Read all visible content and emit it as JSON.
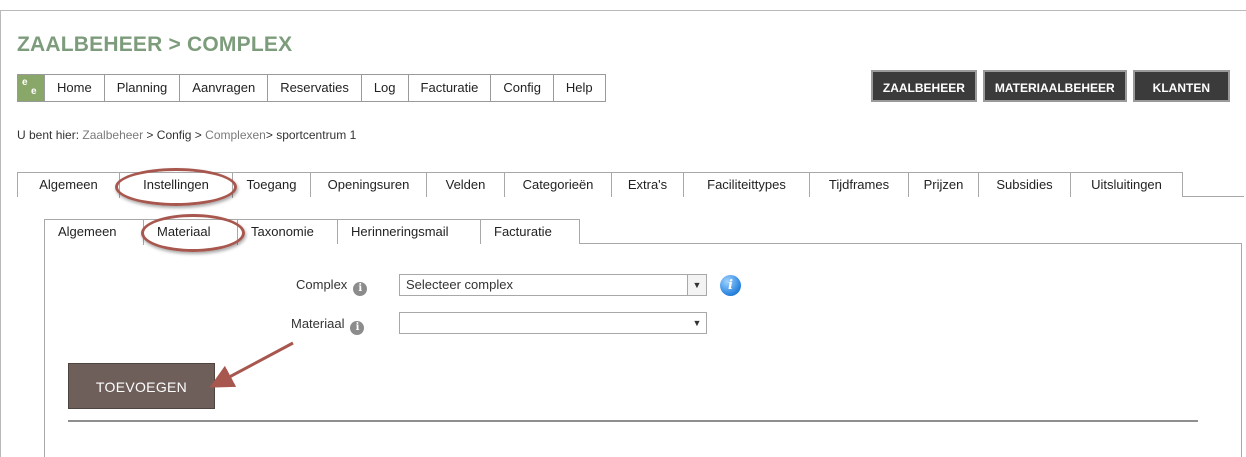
{
  "page_title": "ZAALBEHEER > COMPLEX",
  "main_nav": {
    "logo_text": "e e",
    "items": [
      "Home",
      "Planning",
      "Aanvragen",
      "Reservaties",
      "Log",
      "Facturatie",
      "Config",
      "Help"
    ]
  },
  "top_buttons": [
    "ZAALBEHEER",
    "MATERIAALBEHEER",
    "KLANTEN"
  ],
  "breadcrumb": {
    "prefix": "U bent hier: ",
    "crumb1": "Zaalbeheer",
    "sep1": " > ",
    "crumb2": "Config",
    "sep2": " > ",
    "crumb3": "Complexen",
    "sep3": "> ",
    "current": "sportcentrum 1"
  },
  "tabs_level1": [
    "Algemeen",
    "Instellingen",
    "Toegang",
    "Openingsuren",
    "Velden",
    "Categorieën",
    "Extra's",
    "Faciliteittypes",
    "Tijdframes",
    "Prijzen",
    "Subsidies",
    "Uitsluitingen"
  ],
  "tabs_level1_active": "Instellingen",
  "tabs_level2": [
    "Algemeen",
    "Materiaal",
    "Taxonomie",
    "Herinneringsmail",
    "Facturatie"
  ],
  "tabs_level2_active": "Materiaal",
  "form": {
    "complex_label": "Complex",
    "complex_value": "Selecteer complex",
    "materiaal_label": "Materiaal",
    "materiaal_value": "",
    "info_glyph": "i"
  },
  "add_button": "TOEVOEGEN"
}
